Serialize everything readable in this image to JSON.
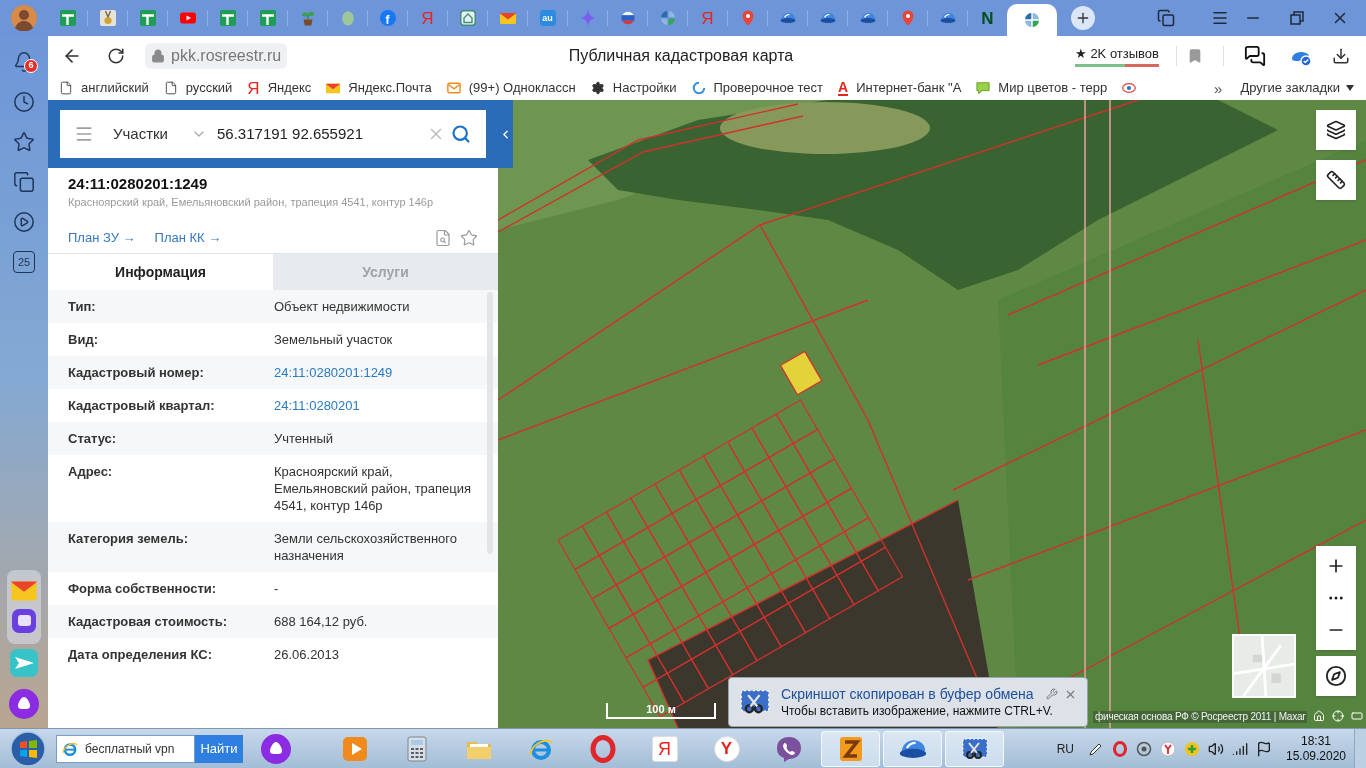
{
  "tabs": [
    {
      "kind": "sheet",
      "selected": false
    },
    {
      "kind": "medal",
      "selected": false
    },
    {
      "kind": "sheet",
      "selected": false
    },
    {
      "kind": "video",
      "selected": false
    },
    {
      "kind": "sheet",
      "selected": false
    },
    {
      "kind": "sheet",
      "selected": false
    },
    {
      "kind": "sprout",
      "selected": false
    },
    {
      "kind": "egg",
      "selected": false
    },
    {
      "kind": "roundletter",
      "glyph": "f",
      "selected": false
    },
    {
      "kind": "redletter",
      "glyph": "Я",
      "selected": false
    },
    {
      "kind": "house",
      "selected": false
    },
    {
      "kind": "mail",
      "selected": false
    },
    {
      "kind": "tileletter",
      "glyph": "au",
      "selected": false
    },
    {
      "kind": "sparkle",
      "selected": false
    },
    {
      "kind": "flag",
      "selected": false
    },
    {
      "kind": "quad",
      "selected": false
    },
    {
      "kind": "redletter",
      "glyph": "Я",
      "selected": false
    },
    {
      "kind": "pin",
      "selected": false
    },
    {
      "kind": "dish",
      "selected": false
    },
    {
      "kind": "dish",
      "selected": false
    },
    {
      "kind": "dish",
      "selected": false
    },
    {
      "kind": "pin",
      "selected": false
    },
    {
      "kind": "dish",
      "selected": false
    },
    {
      "kind": "greenletter",
      "glyph": "N",
      "selected": false
    },
    {
      "kind": "quad",
      "selected": true
    }
  ],
  "address_bar": {
    "url": "pkk.rosreestr.ru",
    "page_title": "Публичная кадастровая карта",
    "reviews": "★ 2K отзывов"
  },
  "sidebar": {
    "notifications_badge": "6",
    "calendar_day": "25"
  },
  "bookmarks": [
    {
      "kind": "page",
      "label": "английский"
    },
    {
      "kind": "page",
      "label": "русский"
    },
    {
      "kind": "redletter",
      "glyph": "Я",
      "label": "Яндекс"
    },
    {
      "kind": "mail",
      "label": "Яндекс.Почта"
    },
    {
      "kind": "envelope",
      "label": "(99+) Одноклассн"
    },
    {
      "kind": "gear",
      "label": "Настройки"
    },
    {
      "kind": "ring",
      "label": "Проверочное тест"
    },
    {
      "kind": "underlined",
      "glyph": "A",
      "label": "Интернет-банк \"А"
    },
    {
      "kind": "bubble",
      "label": "Мир цветов - терр"
    },
    {
      "kind": "eye"
    }
  ],
  "bookmarks_overflow": "»",
  "other_bookmarks": "Другие закладки",
  "search": {
    "category": "Участки",
    "value": "56.317191 92.655921"
  },
  "parcel": {
    "number": "24:11:0280201:1249",
    "address": "Красноярский край, Емельяновский район, трапеция 4541, контур 146р",
    "links": [
      "План ЗУ →",
      "План КК →"
    ]
  },
  "panel_tabs": [
    {
      "label": "Информация",
      "selected": true
    },
    {
      "label": "Услуги",
      "selected": false
    }
  ],
  "info_rows": [
    {
      "label": "Тип:",
      "value": "Объект недвижимости",
      "kind": "text"
    },
    {
      "label": "Вид:",
      "value": "Земельный участок",
      "kind": "text"
    },
    {
      "label": "Кадастровый номер:",
      "value": "24:11:0280201:1249",
      "kind": "link"
    },
    {
      "label": "Кадастровый квартал:",
      "value": "24:11:0280201",
      "kind": "link"
    },
    {
      "label": "Статус:",
      "value": "Учтенный",
      "kind": "text"
    },
    {
      "label": "Адрес:",
      "value": "Красноярский край, Емельяновский район, трапеция 4541, контур 146р",
      "kind": "text"
    },
    {
      "label": "Категория земель:",
      "value": "Земли сельскохозяйственного назначения",
      "kind": "text"
    },
    {
      "label": "Форма собственности:",
      "value": "-",
      "kind": "text"
    },
    {
      "label": "Кадастровая стоимость:",
      "value": "688 164,12 руб.",
      "kind": "text"
    },
    {
      "label": "Дата определения КС:",
      "value": "26.06.2013",
      "kind": "text"
    }
  ],
  "map": {
    "scale": "100 м",
    "attribution": "фическая основа РФ © Росреестр 2011 | Maxar"
  },
  "notification": {
    "title": "Скриншот скопирован в буфер обмена",
    "message": "Чтобы вставить изображение, нажмите CTRL+V."
  },
  "taskbar": {
    "search": {
      "value": "бесплатный vpn",
      "button": "Найти"
    },
    "apps": [
      {
        "kind": "player",
        "open": false
      },
      {
        "kind": "calculator",
        "open": false
      },
      {
        "kind": "folder",
        "open": false
      },
      {
        "kind": "swoosh",
        "open": false
      },
      {
        "kind": "opera",
        "open": false
      },
      {
        "kind": "redletter",
        "glyph": "Я",
        "open": false
      },
      {
        "kind": "circleletter",
        "glyph": "Y",
        "open": false
      },
      {
        "kind": "viber",
        "open": false
      },
      {
        "kind": "bolt",
        "open": true
      },
      {
        "kind": "dish",
        "open": true
      },
      {
        "kind": "scissors",
        "open": true
      }
    ],
    "language": "RU",
    "time": "18:31",
    "date": "15.09.2020"
  }
}
